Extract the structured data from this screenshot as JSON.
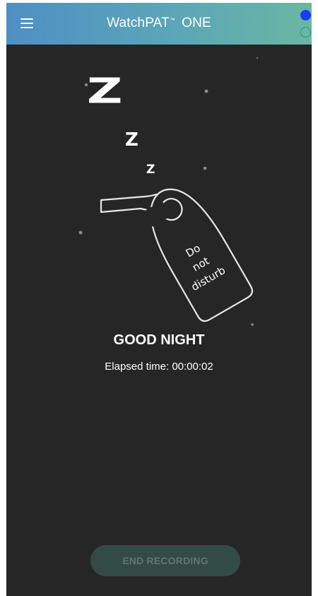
{
  "app_bar": {
    "title": "WatchPAT",
    "trademark": "™",
    "title_suffix": "ONE",
    "menu_icon": "hamburger-menu-icon",
    "status_indicators": [
      {
        "name": "status-dot-filled",
        "color": "#1a3df0"
      },
      {
        "name": "status-dot-hollow",
        "color": "#1a9a8a"
      }
    ]
  },
  "illustration": {
    "snore_letters": [
      "Z",
      "Z",
      "Z"
    ],
    "door_hanger_text": [
      "Do",
      "not",
      "disturb"
    ]
  },
  "main": {
    "greeting": "GOOD NIGHT",
    "elapsed_label": "Elapsed time: 00:00:02"
  },
  "actions": {
    "end_recording_label": "END RECORDING",
    "end_recording_enabled": false
  },
  "colors": {
    "background": "#262626",
    "button_background": "#334b45",
    "button_text": "#5f7470"
  }
}
